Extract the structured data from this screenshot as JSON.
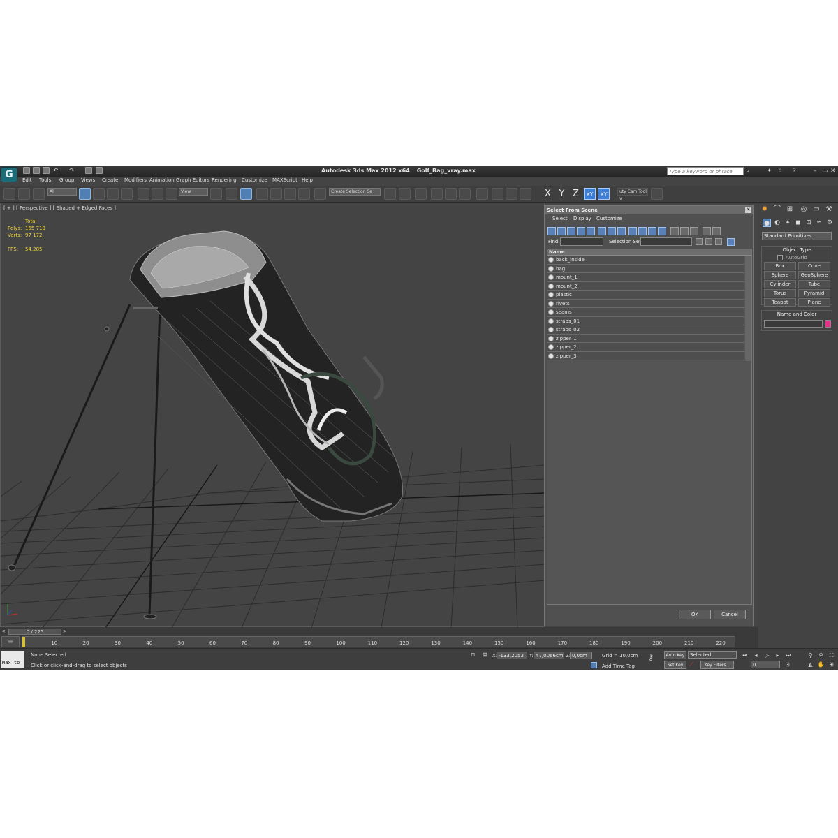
{
  "app": {
    "title": "Autodesk 3ds Max  2012 x64",
    "file": "Golf_Bag_vray.max",
    "search_placeholder": "Type a keyword or phrase"
  },
  "menu": [
    "Edit",
    "Tools",
    "Group",
    "Views",
    "Create",
    "Modifiers",
    "Animation",
    "Graph Editors",
    "Rendering",
    "Customize",
    "MAXScript",
    "Help"
  ],
  "toolbar": {
    "filter": "All",
    "ref_coord": "View",
    "named_selection": "Create Selection Se",
    "axes": [
      "X",
      "Y",
      "Z",
      "XY",
      "XY"
    ],
    "utility": "uty Cam Tool v"
  },
  "viewport": {
    "label": "[ + ] [ Perspective ] [ Shaded + Edged Faces ]",
    "stats": {
      "total_label": "Total",
      "polys_label": "Polys:",
      "polys": "155 713",
      "verts_label": "Verts:",
      "verts": "97 172",
      "fps_label": "FPS:",
      "fps": "54,285"
    }
  },
  "dialog": {
    "title": "Select From Scene",
    "menu": [
      "Select",
      "Display",
      "Customize"
    ],
    "find_label": "Find:",
    "selection_set_label": "Selection Set:",
    "column_name": "Name",
    "items": [
      "back_inside",
      "bag",
      "mount_1",
      "mount_2",
      "plastic",
      "rivets",
      "seams",
      "straps_01",
      "straps_02",
      "zipper_1",
      "zipper_2",
      "zipper_3"
    ],
    "ok": "OK",
    "cancel": "Cancel"
  },
  "command_panel": {
    "category": "Standard Primitives",
    "object_type_title": "Object Type",
    "autogrid": "AutoGrid",
    "buttons": [
      "Box",
      "Cone",
      "Sphere",
      "GeoSphere",
      "Cylinder",
      "Tube",
      "Torus",
      "Pyramid",
      "Teapot",
      "Plane"
    ],
    "name_color_title": "Name and Color",
    "object_color": "#e0338a"
  },
  "timeline": {
    "slider": "0 / 225",
    "ticks": [
      "10",
      "20",
      "30",
      "40",
      "50",
      "60",
      "70",
      "80",
      "90",
      "100",
      "110",
      "120",
      "130",
      "140",
      "150",
      "160",
      "170",
      "180",
      "190",
      "200",
      "210",
      "220"
    ]
  },
  "status": {
    "maxscript": "Max to",
    "selection": "None Selected",
    "prompt": "Click or click-and-drag to select objects",
    "x_label": "X:",
    "x": "-133,2053",
    "y_label": "Y:",
    "y": "47,0066cm",
    "z_label": "Z:",
    "z": "0,0cm",
    "grid": "Grid = 10,0cm",
    "add_time_tag": "Add Time Tag",
    "auto_key": "Auto Key",
    "selected": "Selected",
    "set_key": "Set Key",
    "key_filters": "Key Filters...",
    "frame": "0"
  }
}
